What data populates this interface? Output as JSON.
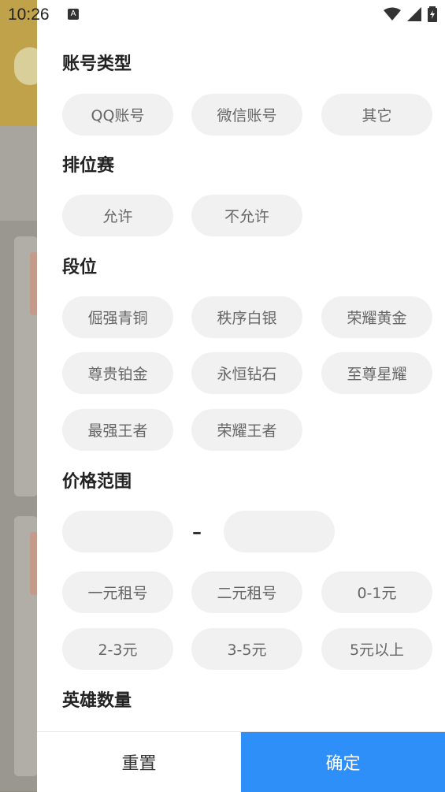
{
  "status_bar": {
    "time": "10:26",
    "notification_icon": "A"
  },
  "colors": {
    "accent": "#2f8ff8",
    "chip_bg": "#f1f1f1",
    "chip_text": "#666666"
  },
  "filter": {
    "account_type": {
      "title": "账号类型",
      "options": [
        "QQ账号",
        "微信账号",
        "其它"
      ]
    },
    "ranked": {
      "title": "排位赛",
      "options": [
        "允许",
        "不允许"
      ]
    },
    "rank": {
      "title": "段位",
      "options": [
        "倔强青铜",
        "秩序白银",
        "荣耀黄金",
        "尊贵铂金",
        "永恒钻石",
        "至尊星耀",
        "最强王者",
        "荣耀王者"
      ]
    },
    "price": {
      "title": "价格范围",
      "separator": "–",
      "min_value": "",
      "max_value": "",
      "options": [
        "一元租号",
        "二元租号",
        "0-1元",
        "2-3元",
        "3-5元",
        "5元以上"
      ]
    },
    "heroes": {
      "title": "英雄数量"
    }
  },
  "footer": {
    "reset_label": "重置",
    "confirm_label": "确定"
  }
}
